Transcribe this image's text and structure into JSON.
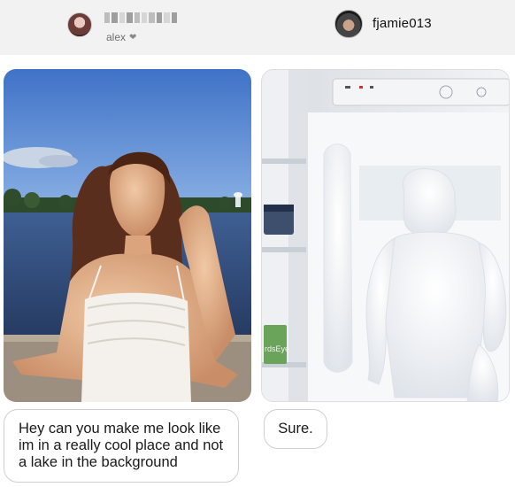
{
  "header": {
    "left_user": {
      "display_name": "alex",
      "name_icon": "heart-icon",
      "username_obscured": true
    },
    "right_user": {
      "username": "fjamie013"
    }
  },
  "photos": {
    "left": {
      "subject": "woman-by-lake"
    },
    "right": {
      "subject": "frozen-figure-in-freezer",
      "package_text": "rdsEye"
    }
  },
  "messages": {
    "left": "Hey can you make me look like im in a really cool place and not a lake in the background",
    "right": "Sure."
  },
  "colors": {
    "background": "#ffffff",
    "header_band": "#f2f2f2",
    "bubble_border": "#cfcfcf",
    "text": "#1a1a1a",
    "muted_text": "#6f6f6f"
  }
}
